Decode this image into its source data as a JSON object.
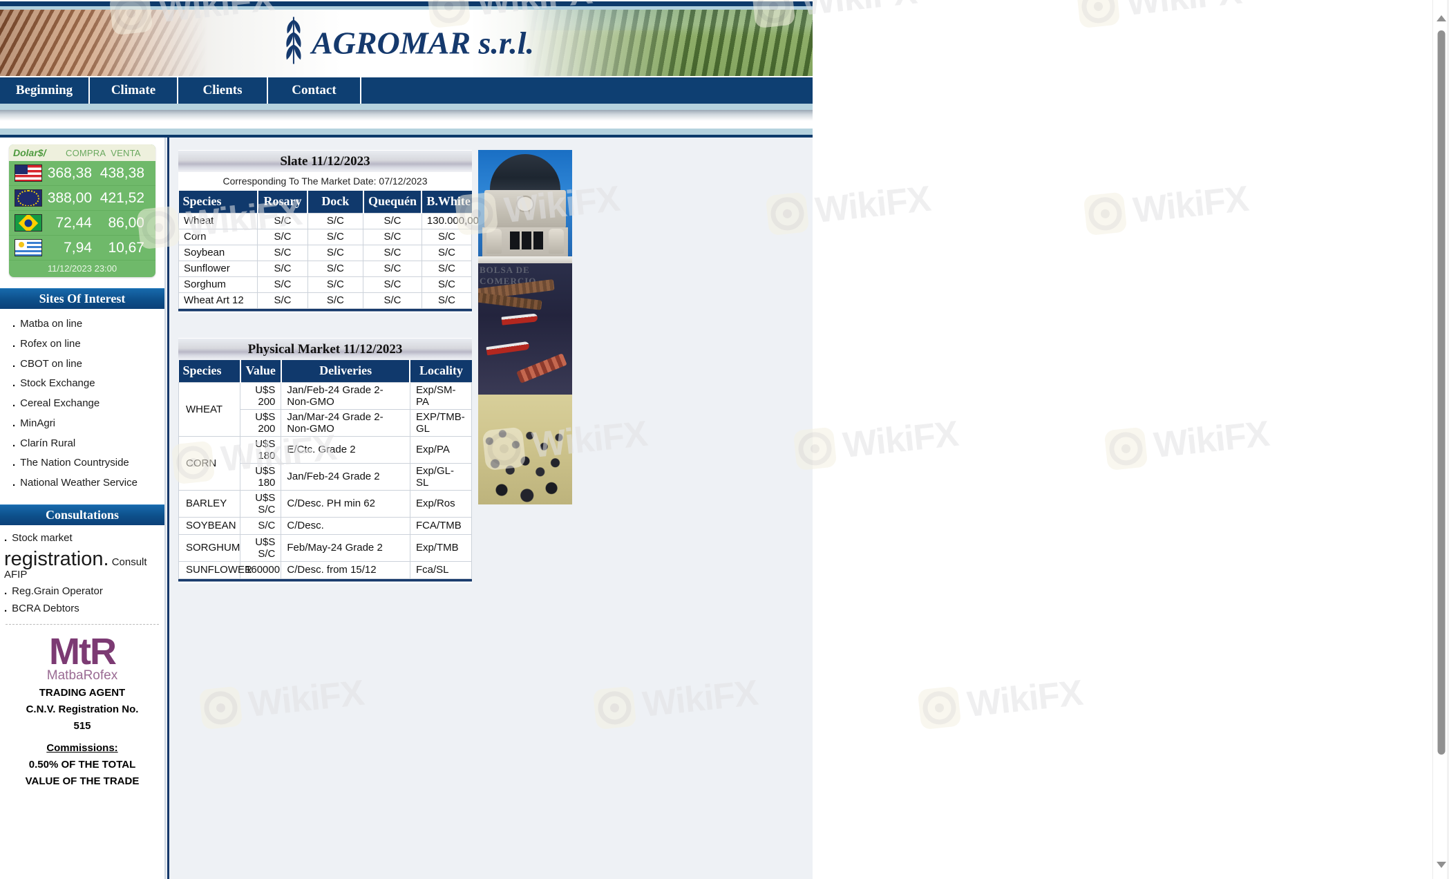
{
  "site": {
    "logo_text": "AGROMAR s.r.l.",
    "logo_icon": "wheat-sheaf-icon"
  },
  "nav": {
    "items": [
      {
        "label": "Beginning"
      },
      {
        "label": "Climate"
      },
      {
        "label": "Clients"
      },
      {
        "label": "Contact"
      }
    ]
  },
  "sidebar": {
    "fx": {
      "brand": "Dolar$/",
      "col_buy": "COMPRA",
      "col_sell": "VENTA",
      "rows": [
        {
          "flag": "flag-us",
          "icon": "us-flag-icon",
          "buy": "368,38",
          "sell": "438,38"
        },
        {
          "flag": "flag-eu",
          "icon": "eu-flag-icon",
          "buy": "388,00",
          "sell": "421,52"
        },
        {
          "flag": "flag-br",
          "icon": "brazil-flag-icon",
          "buy": "72,44",
          "sell": "86,00"
        },
        {
          "flag": "flag-uy",
          "icon": "uruguay-flag-icon",
          "buy": "7,94",
          "sell": "10,67"
        }
      ],
      "timestamp": "11/12/2023 23:00"
    },
    "sites_title": "Sites Of Interest",
    "sites": [
      {
        "label": "Matba on line"
      },
      {
        "label": "Rofex on line"
      },
      {
        "label": "CBOT on line"
      },
      {
        "label": "Stock Exchange"
      },
      {
        "label": "Cereal Exchange"
      },
      {
        "label": "MinAgri"
      },
      {
        "label": "Clarín Rural"
      },
      {
        "label": "The Nation Countryside"
      },
      {
        "label": "National Weather Service"
      }
    ],
    "consultations_title": "Consultations",
    "consultations_first": "Stock market",
    "consultations_reg_big": "registration.",
    "consultations_reg_small": "Consult AFIP",
    "consultations_rest": [
      {
        "label": "Reg.Grain Operator"
      },
      {
        "label": "BCRA Debtors"
      }
    ],
    "mtr": {
      "logo_mark": "MtR",
      "logo_name": "MatbaRofex",
      "line1": "TRADING AGENT",
      "line2": "C.N.V. Registration No.",
      "line3": "515",
      "commissions_label": "Commissions:",
      "line4": "0.50% OF THE TOTAL",
      "line5": "VALUE OF THE TRADE"
    }
  },
  "main": {
    "slate": {
      "title": "Slate 11/12/2023",
      "subtitle": "Corresponding To The Market Date: 07/12/2023",
      "headers": [
        "Species",
        "Rosary",
        "Dock",
        "Quequén",
        "B.White"
      ],
      "rows": [
        [
          "Wheat",
          "S/C",
          "S/C",
          "S/C",
          "130.000,00"
        ],
        [
          "Corn",
          "S/C",
          "S/C",
          "S/C",
          "S/C"
        ],
        [
          "Soybean",
          "S/C",
          "S/C",
          "S/C",
          "S/C"
        ],
        [
          "Sunflower",
          "S/C",
          "S/C",
          "S/C",
          "S/C"
        ],
        [
          "Sorghum",
          "S/C",
          "S/C",
          "S/C",
          "S/C"
        ],
        [
          "Wheat Art 12",
          "S/C",
          "S/C",
          "S/C",
          "S/C"
        ]
      ]
    },
    "physical": {
      "title": "Physical Market 11/12/2023",
      "headers": [
        "Species",
        "Value",
        "Deliveries",
        "Locality"
      ],
      "rows": [
        {
          "species": "WHEAT",
          "span": 2,
          "value": "U$S 200",
          "delivery": "Jan/Feb-24 Grade 2-Non-GMO",
          "locality": "Exp/SM-PA"
        },
        {
          "species": "",
          "span": 0,
          "value": "U$S 200",
          "delivery": "Jan/Mar-24 Grade 2-Non-GMO",
          "locality": "EXP/TMB-GL"
        },
        {
          "species": "CORN",
          "span": 2,
          "value": "U$S 180",
          "delivery": "E/Ctc. Grade 2",
          "locality": "Exp/PA"
        },
        {
          "species": "",
          "span": 0,
          "value": "U$S 180",
          "delivery": "Jan/Feb-24 Grade 2",
          "locality": "Exp/GL-SL"
        },
        {
          "species": "BARLEY",
          "span": 1,
          "value": "U$S S/C",
          "delivery": "C/Desc. PH min 62",
          "locality": "Exp/Ros"
        },
        {
          "species": "SOYBEAN",
          "span": 1,
          "value": "S/C",
          "delivery": "C/Desc.",
          "locality": "FCA/TMB"
        },
        {
          "species": "SORGHUM",
          "span": 1,
          "value": "U$S S/C",
          "delivery": "Feb/May-24 Grade 2",
          "locality": "Exp/TMB"
        },
        {
          "species": "SUNFLOWER",
          "span": 1,
          "value": "160000",
          "delivery": "C/Desc. from 15/12",
          "locality": "Fca/SL"
        }
      ]
    },
    "collage_caption": "BOLSA DE COMERCIO"
  },
  "watermark": {
    "text": "WikiFX"
  },
  "colors": {
    "navy": "#10396c",
    "light_blue": "#b5d2de",
    "green": "#6fb96a",
    "purple": "#7c3a73"
  }
}
